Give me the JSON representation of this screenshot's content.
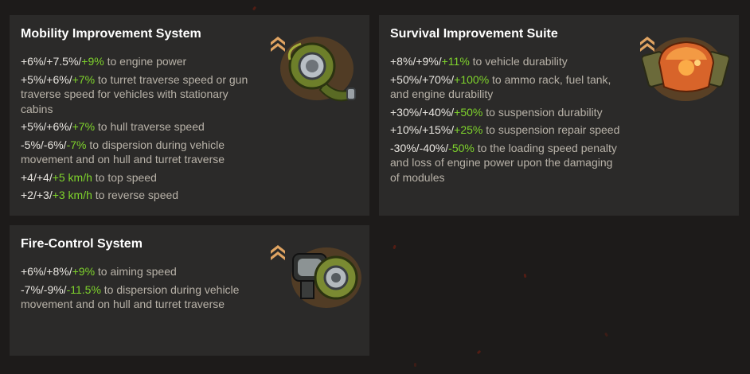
{
  "cards": [
    {
      "title": "Mobility Improvement System",
      "rank_icon": "rank-chevrons-icon",
      "module_icon": "turbocharger-icon",
      "stats": [
        {
          "base": "+6%/+7.5%/",
          "max": "+9%",
          "text": " to engine power"
        },
        {
          "base": "+5%/+6%/",
          "max": "+7%",
          "text": " to turret traverse speed or gun traverse speed for vehicles with stationary cabins"
        },
        {
          "base": "+5%/+6%/",
          "max": "+7%",
          "text": " to hull traverse speed"
        },
        {
          "base": "-5%/-6%/",
          "max": "-7%",
          "text": " to dispersion during vehicle movement and on hull and turret traverse"
        },
        {
          "base": "+4/+4/",
          "max": "+5 km/h",
          "text": " to top speed"
        },
        {
          "base": "+2/+3/",
          "max": "+3 km/h",
          "text": " to reverse speed"
        }
      ]
    },
    {
      "title": "Survival Improvement Suite",
      "rank_icon": "rank-chevrons-icon",
      "module_icon": "armor-kit-icon",
      "stats": [
        {
          "base": "+8%/+9%/",
          "max": "+11%",
          "text": " to vehicle durability"
        },
        {
          "base": "+50%/+70%/",
          "max": "+100%",
          "text": " to ammo rack, fuel tank, and engine durability"
        },
        {
          "base": "+30%/+40%/",
          "max": "+50%",
          "text": " to suspension durability"
        },
        {
          "base": "+10%/+15%/",
          "max": "+25%",
          "text": " to suspension repair speed"
        },
        {
          "base": "-30%/-40%/",
          "max": "-50%",
          "text": " to the loading speed penalty and loss of engine power upon the damaging of modules"
        }
      ]
    },
    {
      "title": "Fire-Control System",
      "rank_icon": "rank-chevrons-icon",
      "module_icon": "fire-control-unit-icon",
      "stats": [
        {
          "base": "+6%/+8%/",
          "max": "+9%",
          "text": " to aiming speed"
        },
        {
          "base": "-7%/-9%/",
          "max": "-11.5%",
          "text": " to dispersion during vehicle movement and on hull and turret traverse"
        }
      ]
    }
  ]
}
